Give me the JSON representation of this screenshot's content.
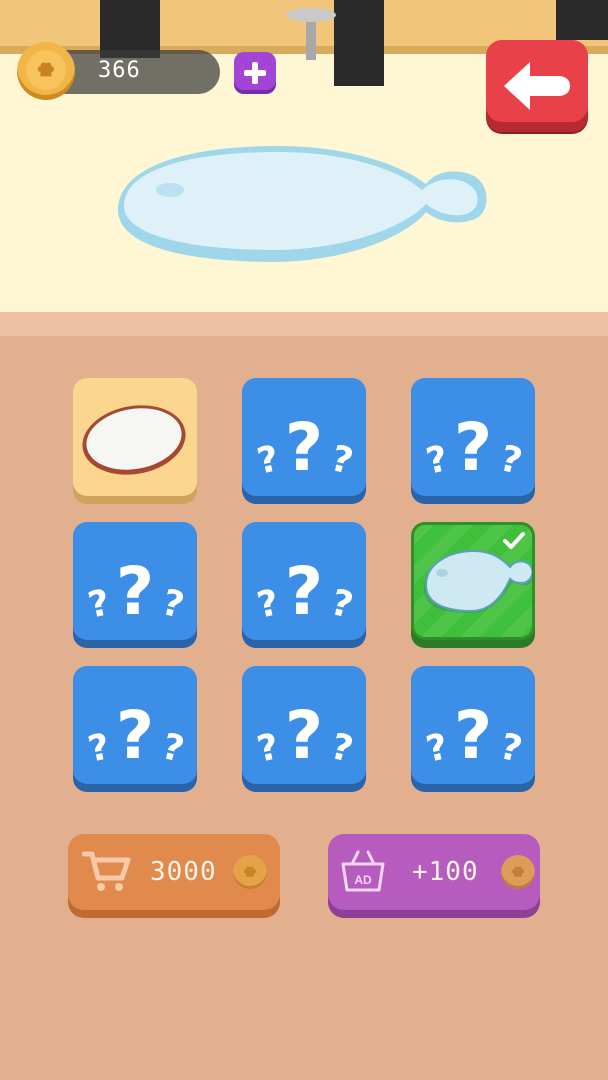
{
  "hud": {
    "coin_icon": "chef-hat-coin",
    "coins": "366",
    "add_icon": "plus-icon",
    "back_icon": "back-arrow-icon"
  },
  "preview": {
    "item": "fish-shaped plate",
    "color": "#cde9f5"
  },
  "grid": {
    "tiles": [
      {
        "state": "owned",
        "item": "round pizza plate"
      },
      {
        "state": "locked",
        "item": "question-marks"
      },
      {
        "state": "locked",
        "item": "question-marks"
      },
      {
        "state": "locked",
        "item": "question-marks"
      },
      {
        "state": "locked",
        "item": "question-marks"
      },
      {
        "state": "selected",
        "item": "fish plate",
        "badge": "checkmark-icon"
      },
      {
        "state": "locked",
        "item": "question-marks"
      },
      {
        "state": "locked",
        "item": "question-marks"
      },
      {
        "state": "locked",
        "item": "question-marks"
      }
    ]
  },
  "buttons": {
    "buy": {
      "icon": "cart-icon",
      "price": "3000"
    },
    "ad": {
      "icon": "ad-basket-icon",
      "reward": "+100"
    }
  },
  "colors": {
    "locked_tile": "#3d8ee6",
    "selected_tile": "#3fbf3a",
    "owned_tile": "#fcd58f",
    "back_button": "#e8414a",
    "plus_button": "#a244d6",
    "buy_button": "#e08a4d",
    "ad_button": "#b65cbf"
  }
}
